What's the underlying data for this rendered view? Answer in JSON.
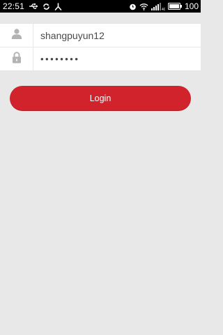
{
  "status_bar": {
    "time": "22:51",
    "battery": "100"
  },
  "login_form": {
    "username_value": "shangpuyun12",
    "password_mask": "••••••••",
    "login_label": "Login"
  },
  "colors": {
    "accent": "#d0232b",
    "background": "#e8e8e8",
    "status_bar": "#000000"
  },
  "icons": {
    "username": "person-icon",
    "password": "lock-icon"
  }
}
